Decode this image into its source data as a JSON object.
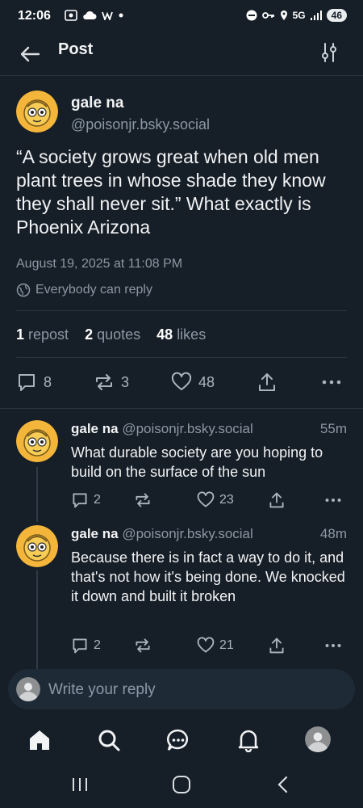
{
  "status_bar": {
    "time": "12:06",
    "network": "5G",
    "battery": "46"
  },
  "header": {
    "title": "Post"
  },
  "post": {
    "author_name": "gale na",
    "author_handle": "@poisonjr.bsky.social",
    "text": "“A society grows great when old men plant trees in whose shade they know they shall never sit.” What exactly is Phoenix Arizona",
    "date": "August 19, 2025 at 11:08 PM",
    "reply_permission": "Everybody can reply",
    "stats": {
      "reposts_count": "1",
      "reposts_label": "repost",
      "quotes_count": "2",
      "quotes_label": "quotes",
      "likes_count": "48",
      "likes_label": "likes"
    },
    "actions": {
      "replies": "8",
      "reposts": "3",
      "likes": "48"
    }
  },
  "replies": [
    {
      "author_name": "gale na",
      "author_handle": "@poisonjr.bsky.social",
      "time": "55m",
      "text": "What durable society are you hoping to build on the surface of the sun",
      "replies": "2",
      "likes": "23"
    },
    {
      "author_name": "gale na",
      "author_handle": "@poisonjr.bsky.social",
      "time": "48m",
      "text": "Because there is in fact a way to do it, and that's not how it's being done. We knocked it down and built it broken",
      "replies": "2",
      "likes": "21"
    }
  ],
  "compose": {
    "placeholder": "Write your reply"
  },
  "tabbar": [
    "home-icon",
    "search-icon",
    "chat-icon",
    "bell-icon",
    "profile-avatar"
  ],
  "colors": {
    "background": "#161e27",
    "accent": "#1083fe",
    "avatar_bg": "#f4b63a"
  }
}
